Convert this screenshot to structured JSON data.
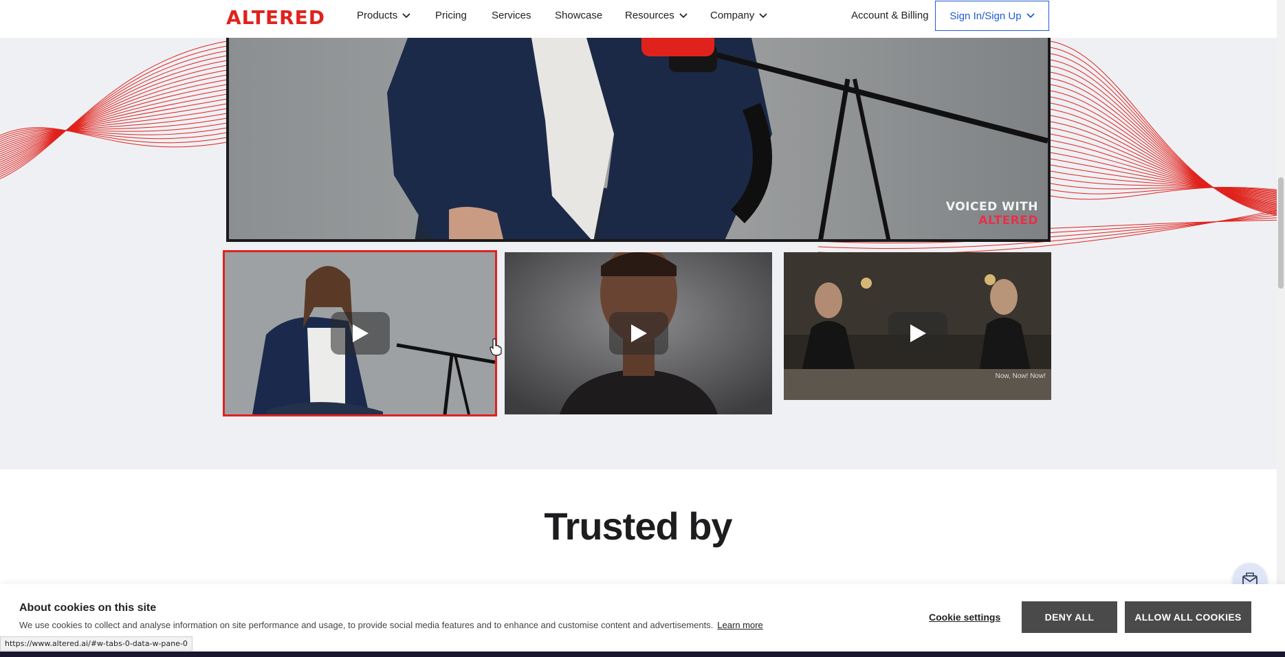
{
  "navbar": {
    "logo_text": "ALTERED",
    "items": [
      {
        "label": "Products",
        "dropdown": true
      },
      {
        "label": "Pricing",
        "dropdown": false
      },
      {
        "label": "Services",
        "dropdown": false
      },
      {
        "label": "Showcase",
        "dropdown": false
      },
      {
        "label": "Resources",
        "dropdown": true
      },
      {
        "label": "Company",
        "dropdown": true
      }
    ],
    "account_link": "Account & Billing",
    "signin_button": "Sign In/Sign Up"
  },
  "main_video": {
    "watermark_line1": "VOICED WITH",
    "watermark_line2": "ALTERED"
  },
  "thumbnails": [
    {
      "active": true,
      "caption": ""
    },
    {
      "active": false,
      "caption": ""
    },
    {
      "active": false,
      "caption": "Now, Now! Now!"
    }
  ],
  "trusted": {
    "title": "Trusted by"
  },
  "cookie_banner": {
    "title": "About cookies on this site",
    "text": "We use cookies to collect and analyse information on site performance and usage, to provide social media features and to enhance and customise content and advertisements.",
    "learn_more": "Learn more",
    "settings": "Cookie settings",
    "deny": "DENY ALL",
    "allow": "ALLOW ALL COOKIES"
  },
  "status_bar": {
    "url": "https://www.altered.ai/#w-tabs-0-data-w-pane-0"
  },
  "colors": {
    "brand_red": "#e0221c",
    "link_blue": "#1e5bd4",
    "cookie_button": "#4a4a4a"
  },
  "icons": [
    "chevron-down-icon",
    "play-icon",
    "chat-widget-icon",
    "hand-cursor-icon"
  ]
}
